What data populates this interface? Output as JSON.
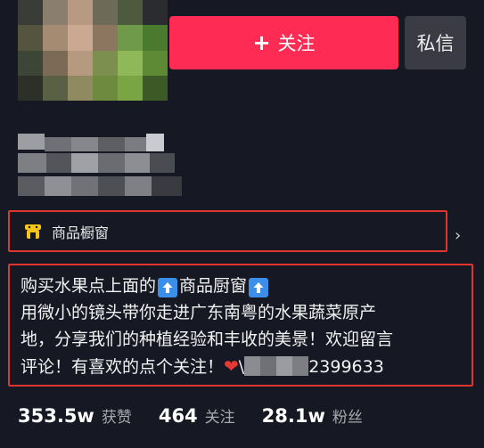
{
  "profile": {
    "follow_button": {
      "icon": "plus-icon",
      "label": "关注"
    },
    "message_button": {
      "label": "私信"
    }
  },
  "shop": {
    "icon": "shop-icon",
    "label": "商品橱窗"
  },
  "bio": {
    "line1_a": "购买水果点上面的",
    "line1_b": "商品厨窗",
    "line2": "用微小的镜头带你走进广东南粤的水果蔬菜原产",
    "line3": "地，分享我们的种植经验和丰收的美景！欢迎留言",
    "line4_a": "评论！有喜欢的点个关注！",
    "line4_b": "\\",
    "line4_c": "2399633"
  },
  "stats": [
    {
      "value": "353.5w",
      "label": "获赞"
    },
    {
      "value": "464",
      "label": "关注"
    },
    {
      "value": "28.1w",
      "label": "粉丝"
    }
  ],
  "colors": {
    "background": "#161823",
    "accent": "#fe2c55",
    "highlight_border": "#e0342f"
  }
}
